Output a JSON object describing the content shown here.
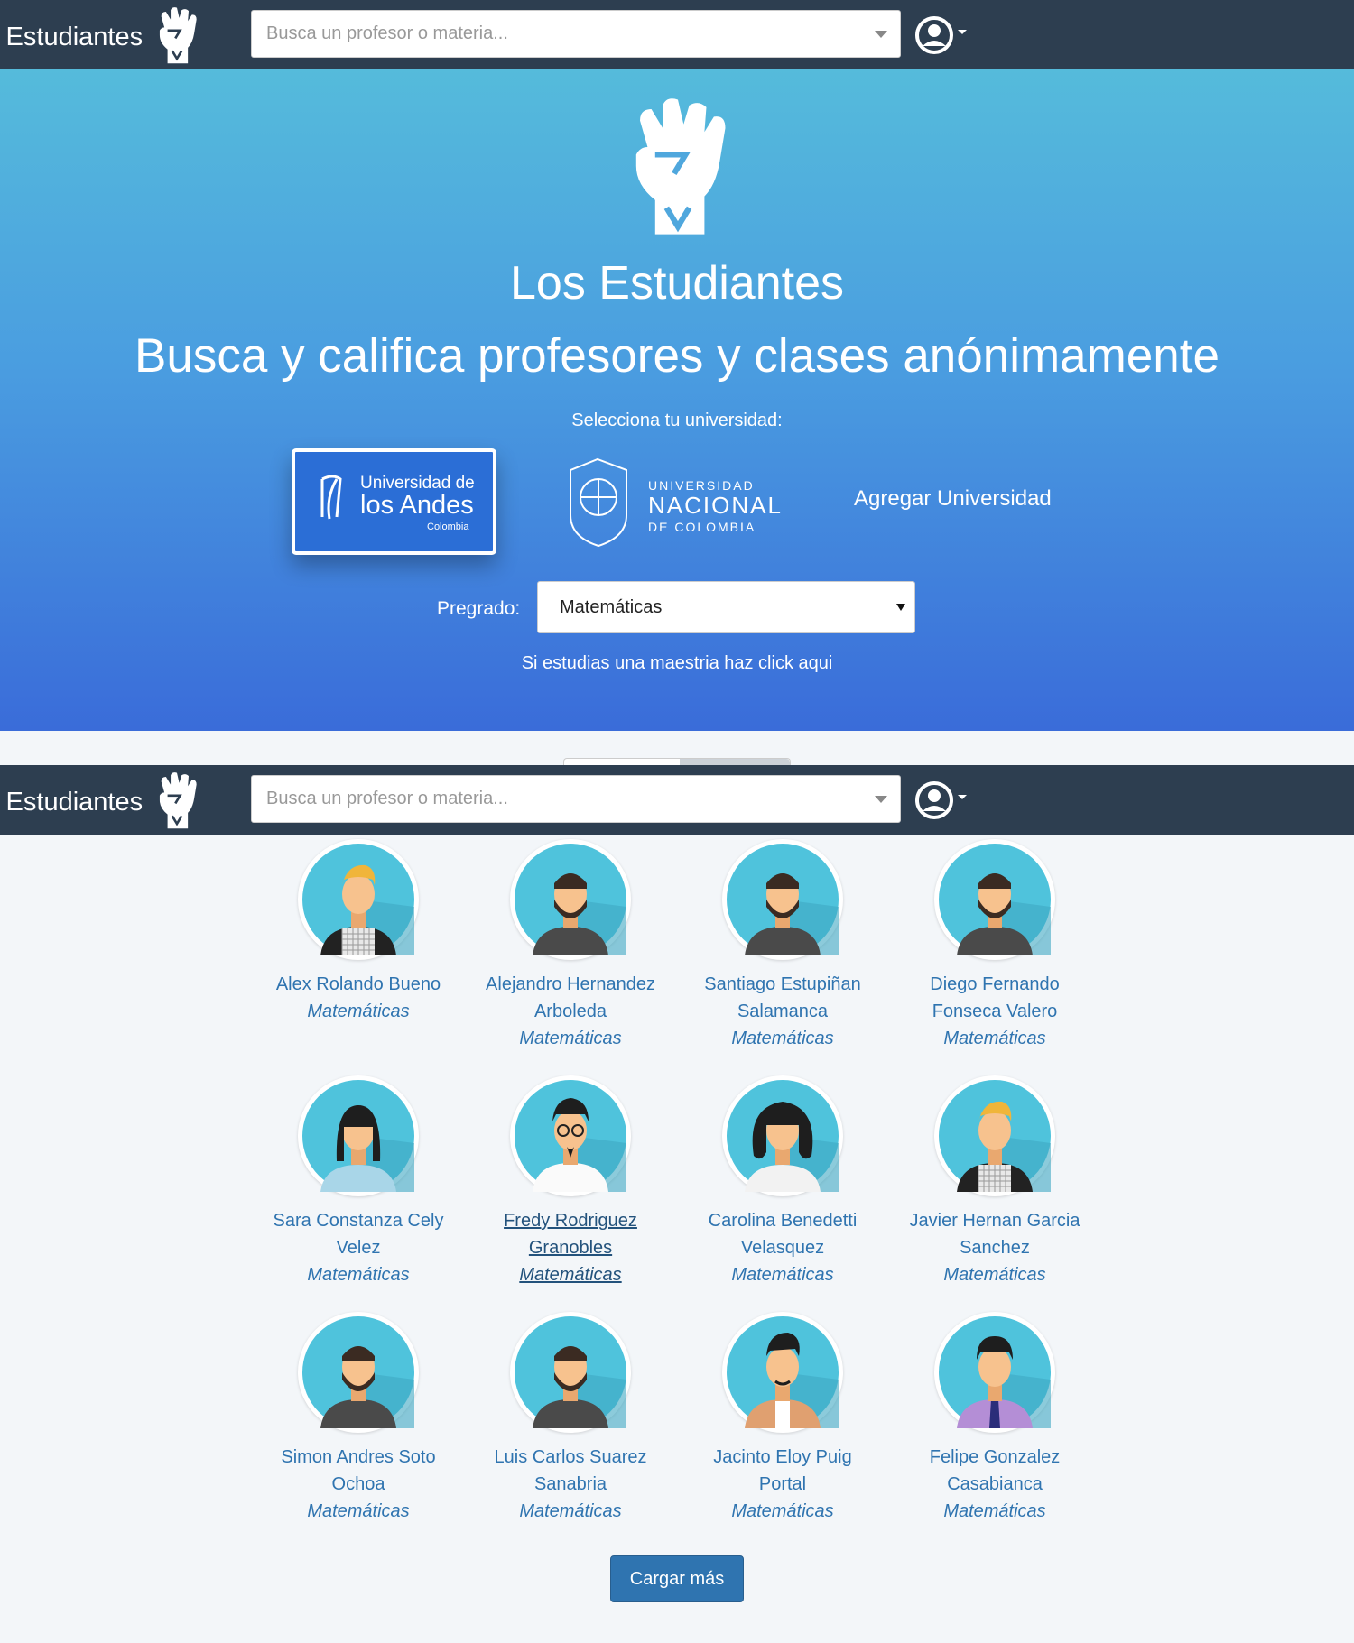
{
  "navbar": {
    "brand": "s Estudiantes",
    "search_placeholder": "Busca un profesor o materia..."
  },
  "hero": {
    "title": "Los Estudiantes",
    "subtitle": "Busca y califica profesores y clases anónimamente",
    "select_university_label": "Selecciona tu universidad:",
    "universities": [
      {
        "name": "Universidad de los Andes",
        "logo_line1": "Universidad de",
        "logo_line2": "los Andes",
        "logo_line3": "Colombia",
        "selected": true
      },
      {
        "name": "Universidad Nacional de Colombia",
        "logo_line1": "UNIVERSIDAD",
        "logo_line2": "NACIONAL",
        "logo_line3": "DE COLOMBIA",
        "selected": false
      }
    ],
    "add_university": "Agregar Universidad",
    "pregrado_label": "Pregrado:",
    "pregrado_value": "Matemáticas",
    "maestria_link": "Si estudias una maestria haz click aqui"
  },
  "professors": [
    {
      "name": "Alex Rolando Bueno",
      "dept": "Matemáticas",
      "avatar": "man-blonde-vest"
    },
    {
      "name": "Alejandro Hernandez Arboleda",
      "dept": "Matemáticas",
      "avatar": "man-beard"
    },
    {
      "name": "Santiago Estupiñan Salamanca",
      "dept": "Matemáticas",
      "avatar": "man-beard"
    },
    {
      "name": "Diego Fernando Fonseca Valero",
      "dept": "Matemáticas",
      "avatar": "man-beard"
    },
    {
      "name": "Sara Constanza Cely Velez",
      "dept": "Matemáticas",
      "avatar": "woman-bangs"
    },
    {
      "name": "Fredy Rodriguez Granobles",
      "dept": "Matemáticas",
      "avatar": "man-glasses"
    },
    {
      "name": "Carolina Benedetti Velasquez",
      "dept": "Matemáticas",
      "avatar": "woman-curly"
    },
    {
      "name": "Javier Hernan Garcia Sanchez",
      "dept": "Matemáticas",
      "avatar": "man-blonde-vest"
    },
    {
      "name": "Simon Andres Soto Ochoa",
      "dept": "Matemáticas",
      "avatar": "man-beard"
    },
    {
      "name": "Luis Carlos Suarez Sanabria",
      "dept": "Matemáticas",
      "avatar": "man-beard"
    },
    {
      "name": "Jacinto Eloy Puig Portal",
      "dept": "Matemáticas",
      "avatar": "man-quiff"
    },
    {
      "name": "Felipe Gonzalez Casabianca",
      "dept": "Matemáticas",
      "avatar": "man-tie"
    }
  ],
  "load_more": "Cargar más",
  "colors": {
    "navbar": "#2d3e50",
    "hero_top": "#55bbdb",
    "hero_bottom": "#3a6cd9",
    "link": "#2f74b0",
    "avatar_bg": "#4fc3dc"
  }
}
